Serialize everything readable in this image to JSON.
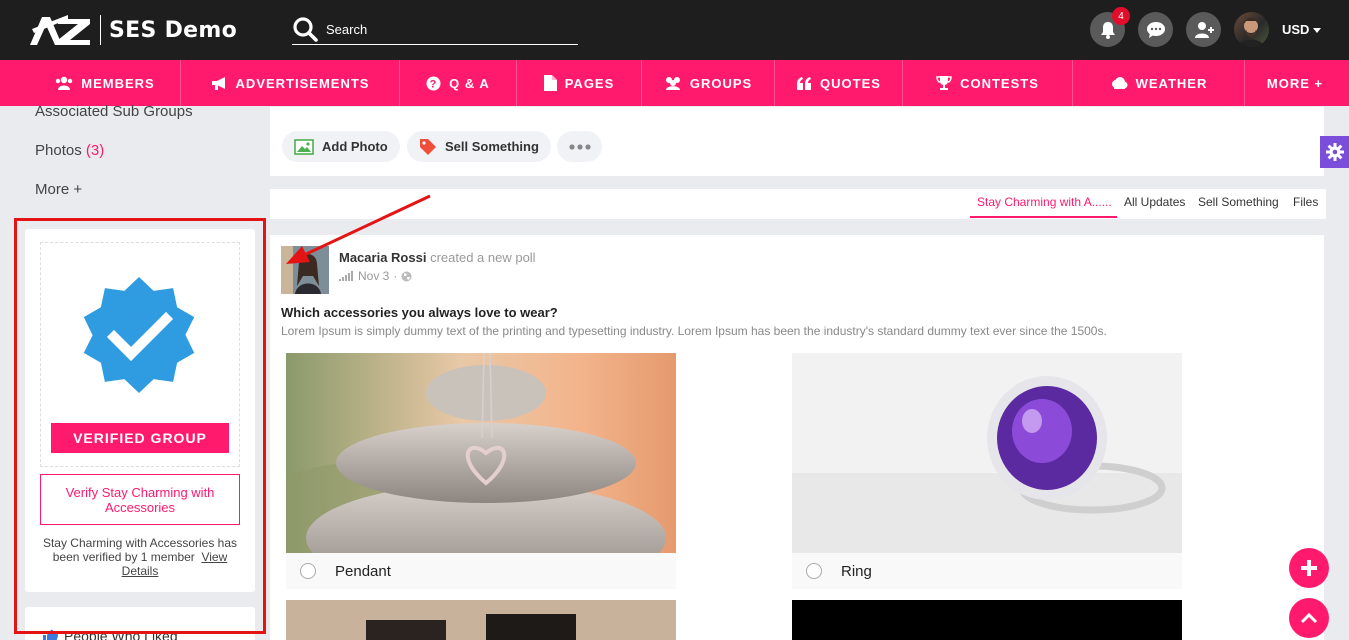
{
  "header": {
    "logo_text": "SES Demo",
    "search_placeholder": "Search",
    "notifications_count": "4",
    "currency": "USD"
  },
  "nav": {
    "items": [
      {
        "label": "MEMBERS",
        "icon": "members-icon"
      },
      {
        "label": "ADVERTISEMENTS",
        "icon": "megaphone-icon"
      },
      {
        "label": "Q & A",
        "icon": "question-icon"
      },
      {
        "label": "PAGES",
        "icon": "page-icon"
      },
      {
        "label": "GROUPS",
        "icon": "groups-icon"
      },
      {
        "label": "QUOTES",
        "icon": "quote-icon"
      },
      {
        "label": "CONTESTS",
        "icon": "trophy-icon"
      },
      {
        "label": "WEATHER",
        "icon": "cloud-icon"
      },
      {
        "label": "MORE +",
        "icon": ""
      }
    ]
  },
  "sidebar": {
    "links": [
      {
        "label": "Associated Sub Groups"
      },
      {
        "label": "Photos",
        "count": "(3)"
      },
      {
        "label": "More +"
      }
    ],
    "verify": {
      "badge_label": "VERIFIED GROUP",
      "button_label": "Verify Stay Charming with Accessories",
      "note": "Stay Charming with Accessories has been verified by 1 member",
      "note_link": "View Details"
    },
    "people_liked": "People Who Liked"
  },
  "composer": {
    "add_photo": "Add Photo",
    "sell_something": "Sell Something"
  },
  "filter_tabs": [
    {
      "label": "Stay Charming with A......",
      "active": true
    },
    {
      "label": "All Updates"
    },
    {
      "label": "Sell Something"
    },
    {
      "label": "Files"
    }
  ],
  "post": {
    "author": "Macaria Rossi",
    "action": "created a new poll",
    "date": "Nov 3",
    "question": "Which accessories you always love to wear?",
    "description": "Lorem Ipsum is simply dummy text of the printing and typesetting industry. Lorem Ipsum has been the industry's standard dummy text ever since the 1500s.",
    "options": [
      {
        "label": "Pendant"
      },
      {
        "label": "Ring"
      }
    ]
  },
  "colors": {
    "brand_pink": "#ff1a6d",
    "topbar": "#1e1e1e",
    "verified_blue": "#2f9be0",
    "annotation_red": "#e41414"
  }
}
